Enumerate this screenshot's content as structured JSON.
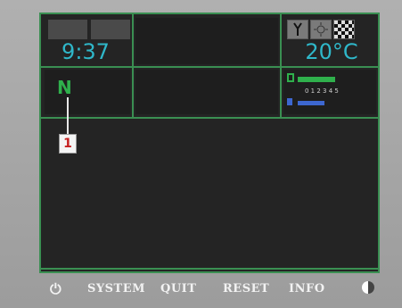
{
  "header": {
    "time": "9:37",
    "temperature": "20°C"
  },
  "status": {
    "gear": "N",
    "callout": "1",
    "gauge_ticks": "0   1   2   3   4   5"
  },
  "menu": {
    "power_icon": "power-icon",
    "system": "SYSTEM",
    "quit": "QUIT",
    "reset": "RESET",
    "info": "INFO",
    "brightness_icon": "brightness-icon"
  },
  "colors": {
    "border": "#3a8f52",
    "text_cyan": "#2fb7c9",
    "gear_green": "#2fb04c"
  },
  "gauges": {
    "fuel_level": 0.55,
    "blue_level": 0.4
  }
}
